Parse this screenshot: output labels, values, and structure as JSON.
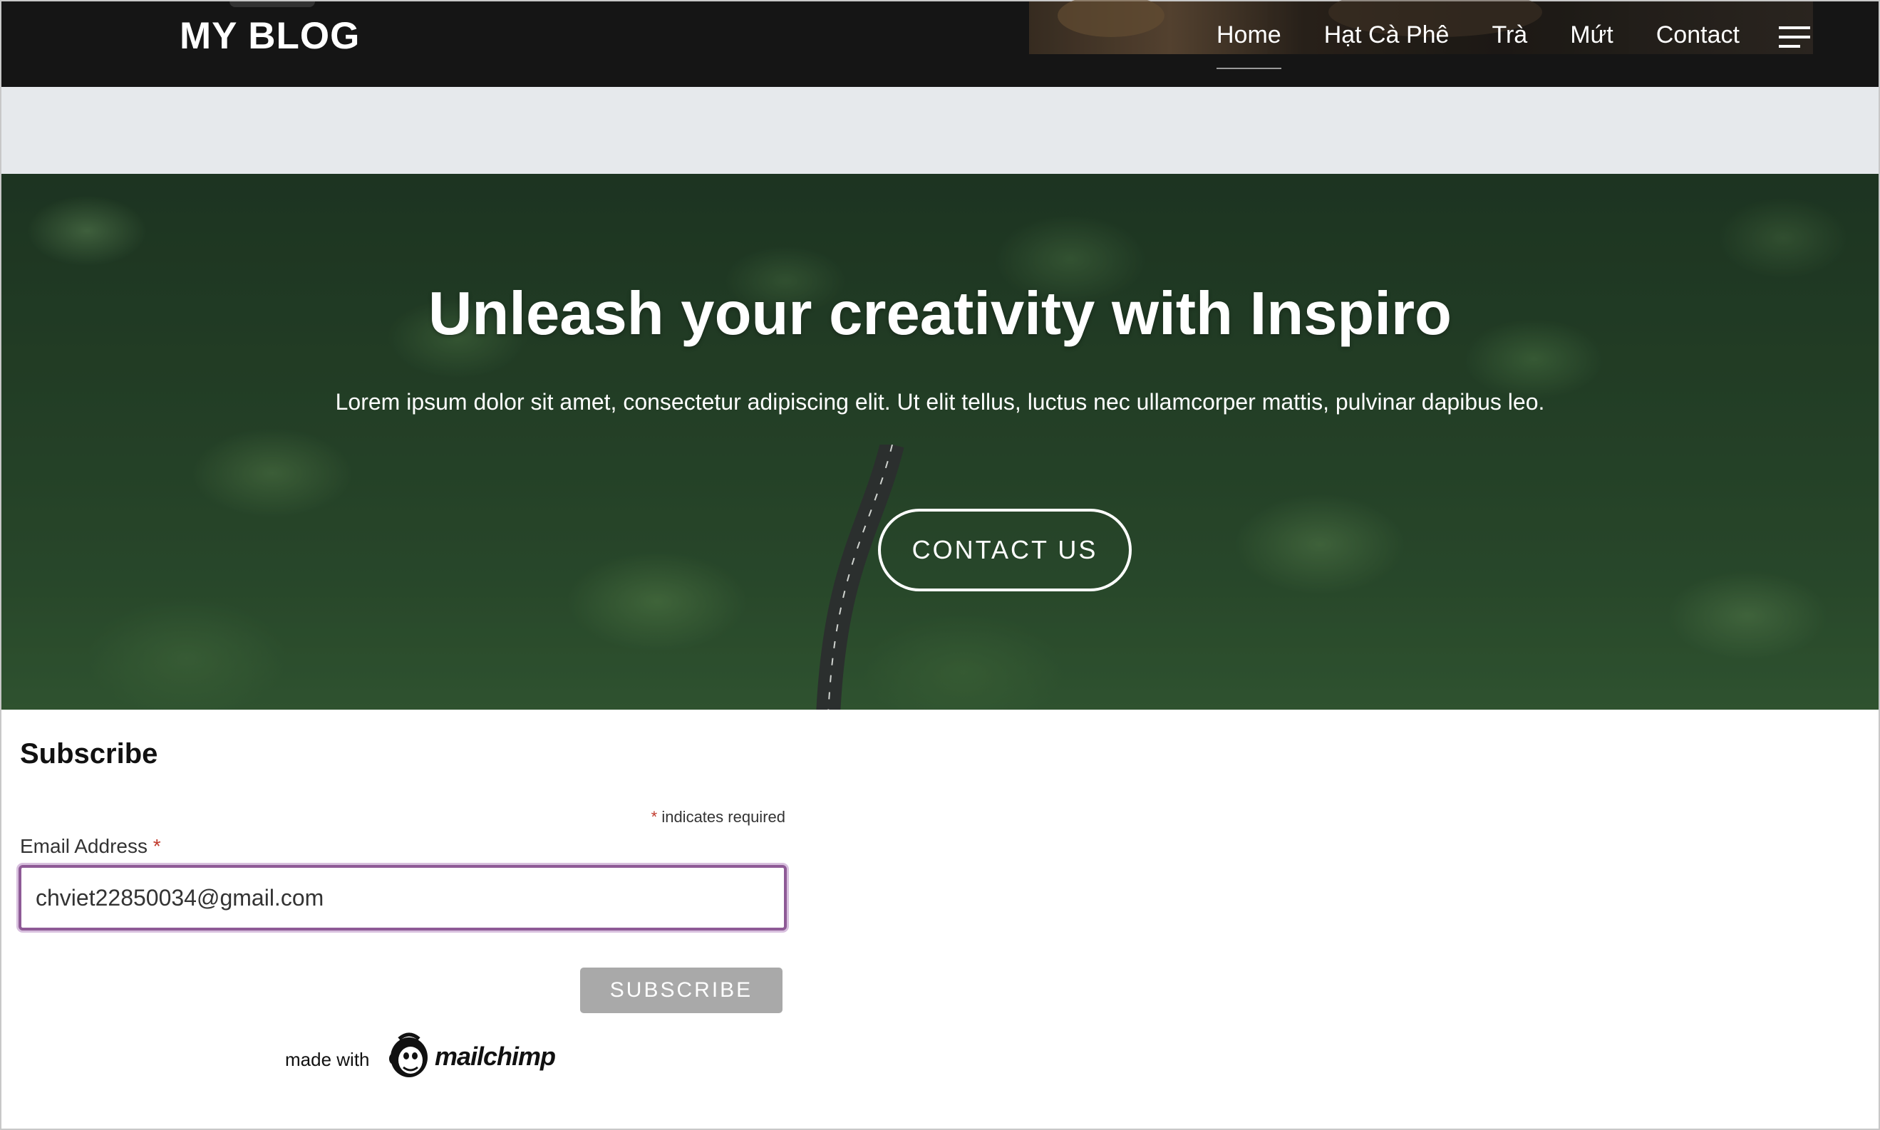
{
  "header": {
    "site_title": "MY BLOG",
    "nav": [
      {
        "label": "Home",
        "active": true
      },
      {
        "label": "Hạt Cà Phê",
        "active": false
      },
      {
        "label": "Trà",
        "active": false
      },
      {
        "label": "Mứt",
        "active": false
      },
      {
        "label": "Contact",
        "active": false
      }
    ],
    "menu_icon": "hamburger-icon"
  },
  "hero": {
    "title": "Unleash your creativity with Inspiro",
    "subtitle": "Lorem ipsum dolor sit amet, consectetur adipiscing elit. Ut elit tellus, luctus nec ullamcorper mattis, pulvinar dapibus leo.",
    "button_label": "CONTACT US"
  },
  "subscribe": {
    "heading": "Subscribe",
    "required_star": "*",
    "required_note": "indicates required",
    "email_label": "Email Address",
    "email_value": "chviet22850034@gmail.com",
    "button_label": "SUBSCRIBE",
    "made_with": "made with",
    "brand": "mailchimp"
  },
  "colors": {
    "header_bg": "#151515",
    "grey_band": "#e6e9ec",
    "input_focus": "#8e5a96",
    "subscribe_btn": "#a9a9a9",
    "required_star": "#c0392b"
  }
}
